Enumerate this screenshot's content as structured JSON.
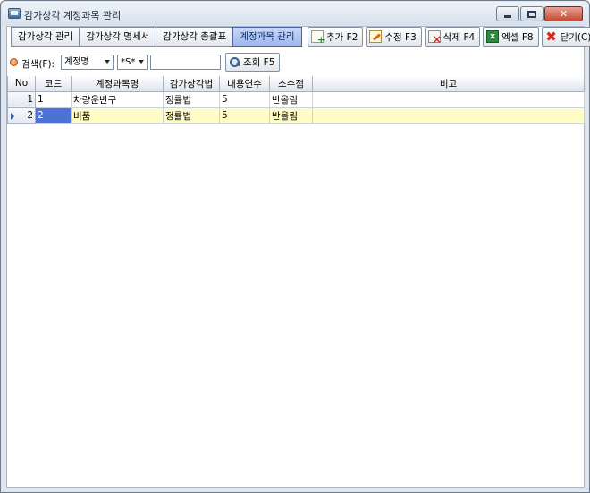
{
  "window": {
    "title": "감가상각 계정과목 관리"
  },
  "tabs": [
    {
      "label": "감가상각 관리"
    },
    {
      "label": "감가상각 명세서"
    },
    {
      "label": "감가상각 총괄표"
    },
    {
      "label": "계정과목 관리"
    }
  ],
  "actions": {
    "add": "추가 F2",
    "edit": "수정 F3",
    "delete": "삭제 F4",
    "excel": "엑셀 F8",
    "close": "닫기(C)"
  },
  "search": {
    "label": "검색(F):",
    "field_value": "계정명",
    "match_value": "*S*",
    "input_value": "",
    "query_button": "조회 F5"
  },
  "grid": {
    "columns": [
      "No",
      "코드",
      "계정과목명",
      "감가상각법",
      "내용연수",
      "소수점",
      "비고"
    ],
    "rows": [
      {
        "no": "1",
        "code": "1",
        "name": "차량운반구",
        "method": "정률법",
        "years": "5",
        "decimal": "반올림",
        "note": ""
      },
      {
        "no": "2",
        "code": "2",
        "name": "비품",
        "method": "정률법",
        "years": "5",
        "decimal": "반올림",
        "note": ""
      }
    ],
    "selected_row": 2
  }
}
